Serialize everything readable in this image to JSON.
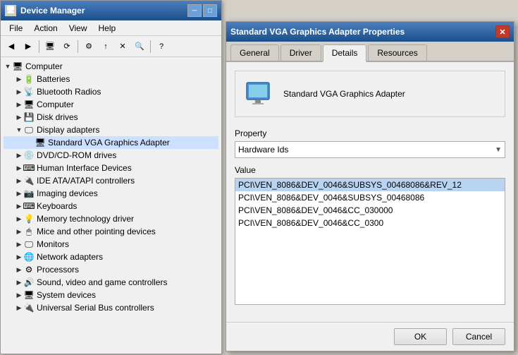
{
  "dm": {
    "title": "Device Manager",
    "menus": [
      "File",
      "Action",
      "View",
      "Help"
    ],
    "tree": [
      {
        "id": "computer",
        "label": "Computer",
        "level": 1,
        "expanded": true,
        "arrow": "▼"
      },
      {
        "id": "batteries",
        "label": "Batteries",
        "level": 2,
        "expanded": false,
        "arrow": "▶"
      },
      {
        "id": "bluetooth",
        "label": "Bluetooth Radios",
        "level": 2,
        "expanded": false,
        "arrow": "▶"
      },
      {
        "id": "computer2",
        "label": "Computer",
        "level": 2,
        "expanded": false,
        "arrow": "▶"
      },
      {
        "id": "diskdrives",
        "label": "Disk drives",
        "level": 2,
        "expanded": false,
        "arrow": "▶"
      },
      {
        "id": "displayadapters",
        "label": "Display adapters",
        "level": 2,
        "expanded": true,
        "arrow": "▼"
      },
      {
        "id": "vga",
        "label": "Standard VGA Graphics Adapter",
        "level": 3,
        "expanded": false,
        "arrow": ""
      },
      {
        "id": "dvd",
        "label": "DVD/CD-ROM drives",
        "level": 2,
        "expanded": false,
        "arrow": "▶"
      },
      {
        "id": "hid",
        "label": "Human Interface Devices",
        "level": 2,
        "expanded": false,
        "arrow": "▶"
      },
      {
        "id": "ide",
        "label": "IDE ATA/ATAPI controllers",
        "level": 2,
        "expanded": false,
        "arrow": "▶"
      },
      {
        "id": "imaging",
        "label": "Imaging devices",
        "level": 2,
        "expanded": false,
        "arrow": "▶"
      },
      {
        "id": "keyboards",
        "label": "Keyboards",
        "level": 2,
        "expanded": false,
        "arrow": "▶"
      },
      {
        "id": "memtech",
        "label": "Memory technology driver",
        "level": 2,
        "expanded": false,
        "arrow": "▶"
      },
      {
        "id": "mice",
        "label": "Mice and other pointing devices",
        "level": 2,
        "expanded": false,
        "arrow": "▶"
      },
      {
        "id": "monitors",
        "label": "Monitors",
        "level": 2,
        "expanded": false,
        "arrow": "▶"
      },
      {
        "id": "network",
        "label": "Network adapters",
        "level": 2,
        "expanded": false,
        "arrow": "▶"
      },
      {
        "id": "processors",
        "label": "Processors",
        "level": 2,
        "expanded": false,
        "arrow": "▶"
      },
      {
        "id": "sound",
        "label": "Sound, video and game controllers",
        "level": 2,
        "expanded": false,
        "arrow": "▶"
      },
      {
        "id": "system",
        "label": "System devices",
        "level": 2,
        "expanded": false,
        "arrow": "▶"
      },
      {
        "id": "usb",
        "label": "Universal Serial Bus controllers",
        "level": 2,
        "expanded": false,
        "arrow": "▶"
      }
    ]
  },
  "props": {
    "title": "Standard VGA Graphics Adapter Properties",
    "tabs": [
      "General",
      "Driver",
      "Details",
      "Resources"
    ],
    "active_tab": "Details",
    "device_name": "Standard VGA Graphics Adapter",
    "property_label": "Property",
    "property_value": "Hardware Ids",
    "value_label": "Value",
    "values": [
      {
        "id": 1,
        "text": "PCI\\VEN_8086&DEV_0046&SUBSYS_00468086&REV_12",
        "selected": true
      },
      {
        "id": 2,
        "text": "PCI\\VEN_8086&DEV_0046&SUBSYS_00468086",
        "selected": false
      },
      {
        "id": 3,
        "text": "PCI\\VEN_8086&DEV_0046&CC_030000",
        "selected": false
      },
      {
        "id": 4,
        "text": "PCI\\VEN_8086&DEV_0046&CC_0300",
        "selected": false
      }
    ],
    "ok_label": "OK",
    "cancel_label": "Cancel"
  }
}
